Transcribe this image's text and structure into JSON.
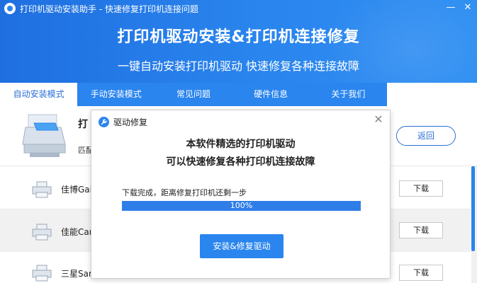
{
  "window": {
    "title": "打印机驱动安装助手 - 快速修复打印机连接问题",
    "minimize_glyph": "—",
    "close_glyph": "✕"
  },
  "banner": {
    "headline": "打印机驱动安装&打印机连接修复",
    "subtitle": "一键自动安装打印机驱动 快速修复各种连接故障"
  },
  "tabs": [
    {
      "label": "自动安装模式",
      "active": true
    },
    {
      "label": "手动安装模式",
      "active": false
    },
    {
      "label": "常见问题",
      "active": false
    },
    {
      "label": "硬件信息",
      "active": false
    },
    {
      "label": "关于我们",
      "active": false
    }
  ],
  "top_panel": {
    "name": "打",
    "sub": "匹配",
    "back_label": "返回"
  },
  "printers": [
    {
      "name": "佳博Gain",
      "download_label": "下载"
    },
    {
      "name": "佳能Cano",
      "download_label": "下载"
    },
    {
      "name": "三星Sam",
      "download_label": "下载"
    }
  ],
  "modal": {
    "title": "驱动修复",
    "close_glyph": "✕",
    "line1": "本软件精选的打印机驱动",
    "line2": "可以快速修复各种打印机连接故障",
    "status": "下载完成，距离修复打印机还剩一步",
    "progress_value": 1.0,
    "progress_label": "100%",
    "install_button": "安装&修复驱动"
  },
  "colors": {
    "brand_blue": "#2a85ee",
    "progress_blue": "#2f7ee8"
  }
}
